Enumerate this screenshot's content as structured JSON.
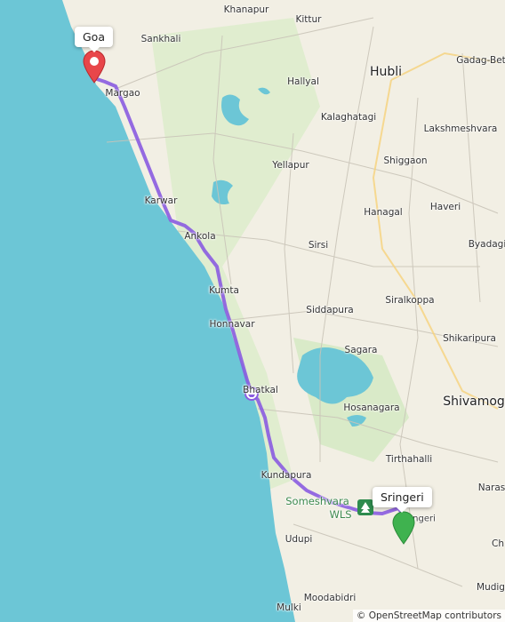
{
  "map": {
    "colors": {
      "sea": "#6cc6d6",
      "land": "#f2efe4",
      "route": "#8a5be0",
      "start_marker": "#e8464a",
      "end_marker": "#3fb24f",
      "lake": "#6cc6d6",
      "forest": "#d6ebc5"
    },
    "start": {
      "label": "Goa",
      "icon": "map-pin-red"
    },
    "end": {
      "label": "Sringeri",
      "icon": "map-pin-green"
    },
    "attribution": "© OpenStreetMap contributors",
    "places": {
      "khanapur": "Khanapur",
      "kittur": "Kittur",
      "sankhali": "Sankhali",
      "gadag": "Gadag-Bet",
      "hubli": "Hubli",
      "margao": "Margao",
      "hallyal": "Hallyal",
      "kalaghatagi": "Kalaghatagi",
      "lakshmeshvara": "Lakshmeshvara",
      "shiggaon": "Shiggaon",
      "yellapur": "Yellapur",
      "karwar": "Karwar",
      "hanagal": "Hanagal",
      "haveri": "Haveri",
      "ankola": "Ankola",
      "sirsi": "Sirsi",
      "byadagi": "Byadagi",
      "kumta": "Kumta",
      "siralkoppa": "Siralkoppa",
      "siddapura": "Siddapura",
      "honnavar": "Honnavar",
      "shikaripura": "Shikaripura",
      "sagara": "Sagara",
      "bhatkal": "Bhatkal",
      "shivamogga": "Shivamog",
      "hosanagara": "Hosanagara",
      "tirthahalli": "Tirthahalli",
      "kundapura": "Kundapura",
      "narasimharajapura": "Naras",
      "someshvara": "Someshvara",
      "wls": "WLS",
      "udupi": "Udupi",
      "moodabidri": "Moodabidri",
      "mulki": "Mulki",
      "mudigere": "Mudig",
      "sringeri_town": "ngeri",
      "ch": "Ch"
    }
  }
}
